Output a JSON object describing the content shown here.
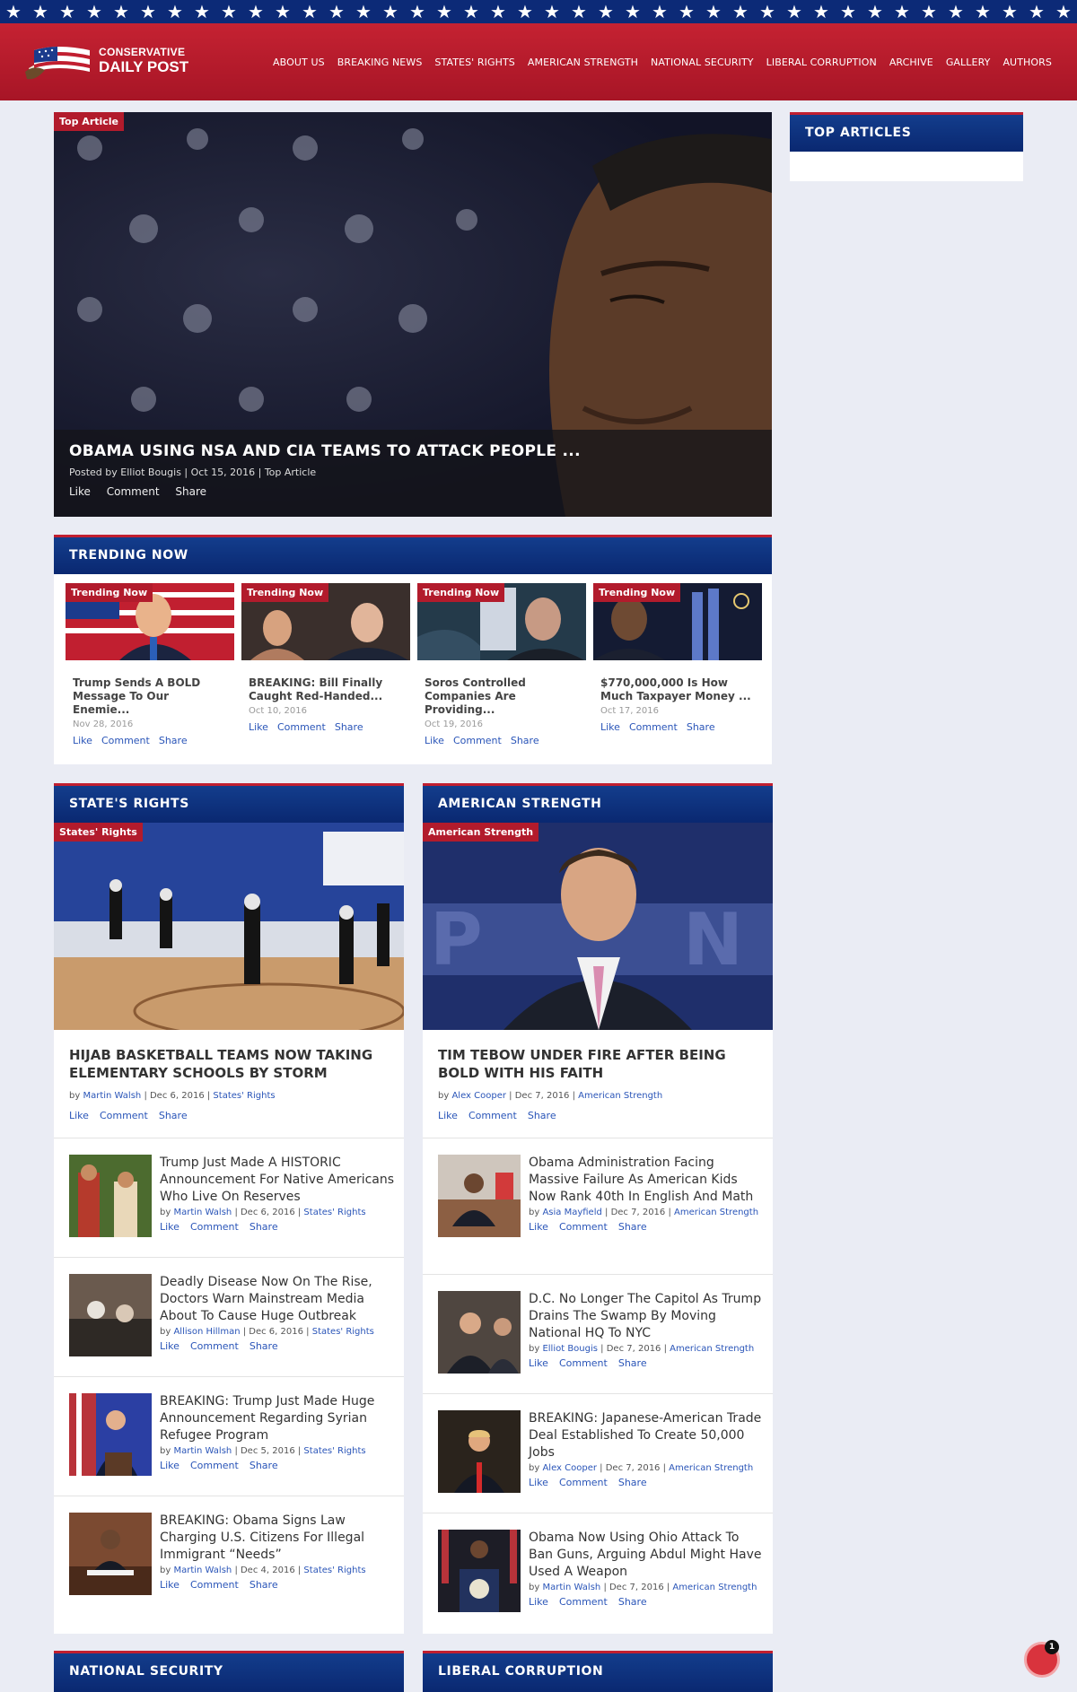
{
  "brand": {
    "line1": "CONSERVATIVE",
    "line2": "DAILY POST"
  },
  "nav": [
    "ABOUT US",
    "BREAKING NEWS",
    "STATES' RIGHTS",
    "AMERICAN STRENGTH",
    "NATIONAL SECURITY",
    "LIBERAL CORRUPTION",
    "ARCHIVE",
    "GALLERY",
    "AUTHORS"
  ],
  "hero": {
    "tag": "Top Article",
    "title": "OBAMA USING NSA AND CIA TEAMS TO ATTACK PEOPLE ...",
    "meta": "Posted by Elliot Bougis | Oct 15, 2016 | Top Article",
    "actions": [
      "Like",
      "Comment",
      "Share"
    ]
  },
  "sidebar": {
    "title": "TOP ARTICLES"
  },
  "trending": {
    "title": "TRENDING NOW",
    "items": [
      {
        "tag": "Trending Now",
        "title": "Trump Sends A BOLD Message To Our Enemie...",
        "date": "Nov 28, 2016"
      },
      {
        "tag": "Trending Now",
        "title": "BREAKING: Bill Finally Caught Red-Handed...",
        "date": "Oct 10, 2016"
      },
      {
        "tag": "Trending Now",
        "title": "Soros Controlled Companies Are Providing...",
        "date": "Oct 19, 2016"
      },
      {
        "tag": "Trending Now",
        "title": "$770,000,000 Is How Much Taxpayer Money ...",
        "date": "Oct 17, 2016"
      }
    ],
    "actions": [
      "Like",
      "Comment",
      "Share"
    ]
  },
  "states": {
    "title": "STATE'S RIGHTS",
    "tag": "States' Rights",
    "feature": {
      "title": "HIJAB BASKETBALL TEAMS NOW TAKING ELEMENTARY SCHOOLS BY STORM",
      "by": "by",
      "author": "Martin Walsh",
      "date": "| Dec 6, 2016 |",
      "category": "States' Rights"
    },
    "items": [
      {
        "title": "Trump Just Made A HISTORIC Announcement For Native Americans Who Live On Reserves",
        "author": "Martin Walsh",
        "date": "| Dec 6, 2016 |",
        "category": "States' Rights"
      },
      {
        "title": "Deadly Disease Now On The Rise, Doctors Warn Mainstream Media About To Cause Huge Outbreak",
        "author": "Allison Hillman",
        "date": "| Dec 6, 2016 |",
        "category": "States' Rights"
      },
      {
        "title": "BREAKING: Trump Just Made Huge Announcement Regarding Syrian Refugee Program",
        "author": "Martin Walsh",
        "date": "| Dec 5, 2016 |",
        "category": "States' Rights"
      },
      {
        "title": "BREAKING: Obama Signs Law Charging U.S. Citizens For Illegal Immigrant “Needs”",
        "author": "Martin Walsh",
        "date": "| Dec 4, 2016 |",
        "category": "States' Rights"
      }
    ]
  },
  "strength": {
    "title": "AMERICAN STRENGTH",
    "tag": "American Strength",
    "feature": {
      "title": "TIM TEBOW UNDER FIRE AFTER BEING BOLD WITH HIS FAITH",
      "by": "by",
      "author": "Alex Cooper",
      "date": "| Dec 7, 2016 |",
      "category": "American Strength"
    },
    "items": [
      {
        "title": "Obama Administration Facing Massive Failure As American Kids Now Rank 40th In English And Math",
        "author": "Asia Mayfield",
        "date": "| Dec 7, 2016 |",
        "category": "American Strength"
      },
      {
        "title": "D.C. No Longer The Capitol As Trump Drains The Swamp By Moving National HQ To NYC",
        "author": "Elliot Bougis",
        "date": "| Dec 7, 2016 |",
        "category": "American Strength"
      },
      {
        "title": "BREAKING: Japanese-American Trade Deal Established To Create 50,000 Jobs",
        "author": "Alex Cooper",
        "date": "| Dec 7, 2016 |",
        "category": "American Strength"
      },
      {
        "title": "Obama Now Using Ohio Attack To Ban Guns, Arguing Abdul Might Have Used A Weapon",
        "author": "Martin Walsh",
        "date": "| Dec 7, 2016 |",
        "category": "American Strength"
      }
    ]
  },
  "actions": {
    "like": "Like",
    "comment": "Comment",
    "share": "Share",
    "by": "by"
  },
  "bottom": {
    "left": "NATIONAL SECURITY",
    "right": "LIBERAL CORRUPTION"
  },
  "chat": {
    "badge": "1"
  },
  "colors": {
    "red": "#b21b2c",
    "navy": "#0a2871",
    "link": "#2a55b8",
    "background": "#eaecf4"
  }
}
